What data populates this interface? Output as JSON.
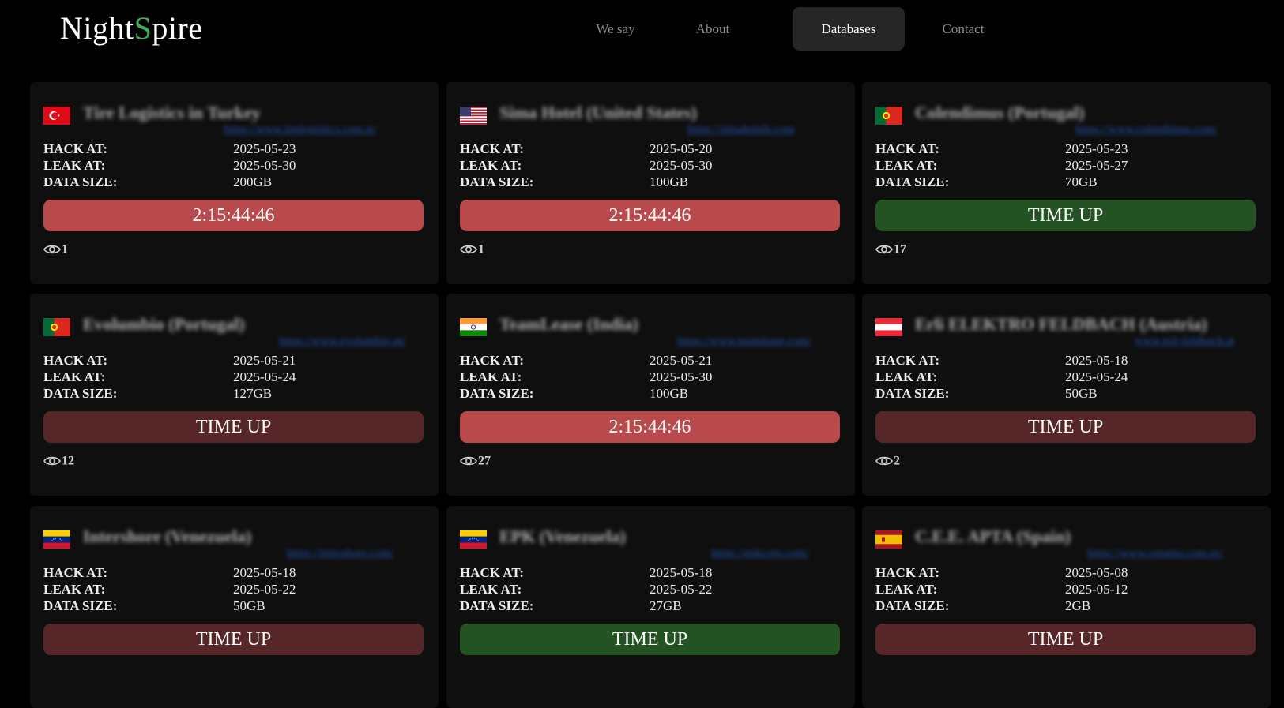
{
  "brand": {
    "part1": "Night",
    "accent": "S",
    "part2": "pire"
  },
  "nav": [
    {
      "label": "We say",
      "active": false
    },
    {
      "label": "About",
      "active": false
    },
    {
      "label": "Databases",
      "active": true
    },
    {
      "label": "Contact",
      "active": false
    }
  ],
  "labels": {
    "hack": "HACK AT:",
    "leak": "LEAK AT:",
    "size": "DATA SIZE:"
  },
  "colors": {
    "timer_red": "#b94a4c",
    "time_up_green": "#235223",
    "time_up_dark": "#562628",
    "accent": "#3fae5c"
  },
  "cards": [
    {
      "flag": "turkey",
      "name": "Tire Logistics in Turkey",
      "url": "https://www.tirelogistics.com.tr/",
      "hack": "2025-05-23",
      "leak": "2025-05-30",
      "size": "200GB",
      "timer": "2:15:44:46",
      "status": "red",
      "views": "1"
    },
    {
      "flag": "usa",
      "name": "Sima Hotel (United States)",
      "url": "https://simahotels.com",
      "hack": "2025-05-20",
      "leak": "2025-05-30",
      "size": "100GB",
      "timer": "2:15:44:46",
      "status": "red",
      "views": "1"
    },
    {
      "flag": "portugal",
      "name": "Colendimus (Portugal)",
      "url": "https://www.colendimus.com/",
      "hack": "2025-05-23",
      "leak": "2025-05-27",
      "size": "70GB",
      "timer": "TIME UP",
      "status": "green",
      "views": "17"
    },
    {
      "flag": "portugal",
      "name": "Evolumbio (Portugal)",
      "url": "https://www.evolumbio.pt/",
      "hack": "2025-05-21",
      "leak": "2025-05-24",
      "size": "127GB",
      "timer": "TIME UP",
      "status": "dark",
      "views": "12"
    },
    {
      "flag": "india",
      "name": "TeamLease (India)",
      "url": "https://www.teamlease.com/",
      "hack": "2025-05-21",
      "leak": "2025-05-30",
      "size": "100GB",
      "timer": "2:15:44:46",
      "status": "red",
      "views": "27"
    },
    {
      "flag": "austria",
      "name": "Erli ELEKTRO FELDBACH (Austria)",
      "url": "www.erli-feldbach.at",
      "hack": "2025-05-18",
      "leak": "2025-05-24",
      "size": "50GB",
      "timer": "TIME UP",
      "status": "dark",
      "views": "2"
    },
    {
      "flag": "venezuela",
      "name": "Intershore (Venezuela)",
      "url": "https://intershore.com/",
      "hack": "2025-05-18",
      "leak": "2025-05-22",
      "size": "50GB",
      "timer": "TIME UP",
      "status": "dark",
      "views": ""
    },
    {
      "flag": "venezuela",
      "name": "EPK (Venezuela)",
      "url": "https://epkcorp.com/",
      "hack": "2025-05-18",
      "leak": "2025-05-22",
      "size": "27GB",
      "timer": "TIME UP",
      "status": "green",
      "views": ""
    },
    {
      "flag": "spain",
      "name": "C.E.E. APTA (Spain)",
      "url": "https://www.ceeapta.com.es/",
      "hack": "2025-05-08",
      "leak": "2025-05-12",
      "size": "2GB",
      "timer": "TIME UP",
      "status": "dark",
      "views": ""
    }
  ]
}
